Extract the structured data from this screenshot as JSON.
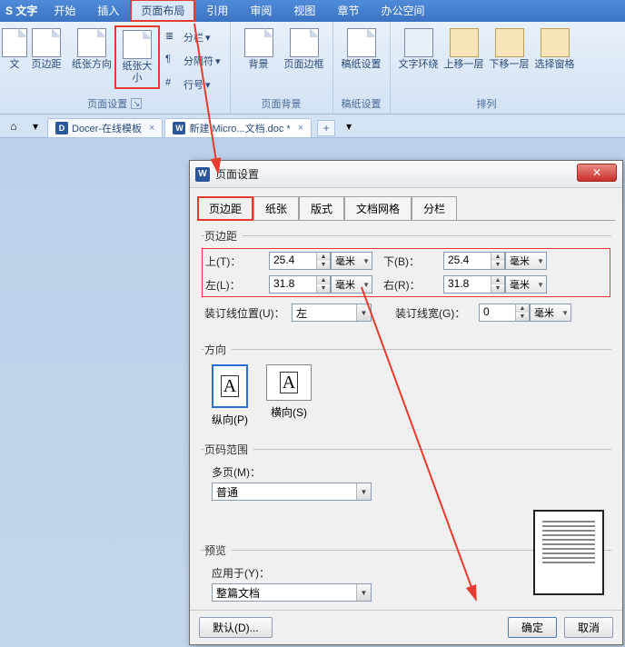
{
  "app": {
    "logo_text": "S 文字"
  },
  "menu": {
    "start": "开始",
    "insert": "插入",
    "layout": "页面布局",
    "ref": "引用",
    "review": "审阅",
    "view": "视图",
    "section": "章节",
    "office": "办公空间"
  },
  "ribbon": {
    "direction": "文",
    "margins": "页边距",
    "pageorient": "纸张方向",
    "pagesize": "纸张大小",
    "columns": "分栏",
    "breaks": "分隔符",
    "linenum": "行号",
    "bg": "背景",
    "border": "页面边框",
    "grid": "稿纸设置",
    "wrap": "文字环绕",
    "forward": "上移一层",
    "backward": "下移一层",
    "selpane": "选择窗格",
    "grp_pagesetup": "页面设置",
    "grp_pagebg": "页面背景",
    "grp_gridset": "稿纸设置",
    "grp_arrange": "排列",
    "dd": "▾"
  },
  "tabs": {
    "tmpl": "Docer-在线模板",
    "tmpl_x": "×",
    "doc": "新建 Micro...文档.doc *",
    "doc_x": "×",
    "add": "+",
    "menu_dd": "▾"
  },
  "dialog": {
    "title": "页面设置",
    "close": "✕",
    "tabs": {
      "margin": "页边距",
      "paper": "纸张",
      "layout": "版式",
      "grid": "文档网格",
      "cols": "分栏"
    },
    "margins": {
      "legend": "页边距",
      "top_lbl": "上(T)：",
      "top_val": "25.4",
      "bottom_lbl": "下(B)：",
      "bottom_val": "25.4",
      "left_lbl": "左(L)：",
      "left_val": "31.8",
      "right_lbl": "右(R)：",
      "right_val": "31.8",
      "unit": "毫米",
      "gutterpos_lbl": "装订线位置(U)：",
      "gutterpos_val": "左",
      "gutterw_lbl": "装订线宽(G)：",
      "gutterw_val": "0"
    },
    "orient": {
      "legend": "方向",
      "portrait": "纵向(P)",
      "landscape": "横向(S)",
      "A": "A"
    },
    "range": {
      "legend": "页码范围",
      "multi_lbl": "多页(M)：",
      "multi_val": "普通"
    },
    "preview": {
      "legend": "预览",
      "apply_lbl": "应用于(Y)：",
      "apply_val": "整篇文档"
    },
    "footer": {
      "default": "默认(D)...",
      "ok": "确定",
      "cancel": "取消"
    }
  }
}
